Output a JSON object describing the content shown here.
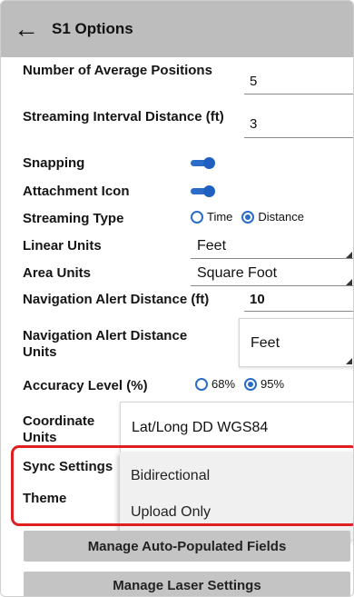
{
  "header": {
    "back_icon": "back-arrow-icon",
    "title": "S1 Options"
  },
  "settings": {
    "avg_positions": {
      "label": "Number of Average Positions",
      "value": "5"
    },
    "streaming_interval": {
      "label": "Streaming Interval Distance (ft)",
      "value": "3"
    },
    "snapping": {
      "label": "Snapping",
      "enabled": true
    },
    "attachment_icon": {
      "label": "Attachment Icon",
      "enabled": true
    },
    "streaming_type": {
      "label": "Streaming Type",
      "options": [
        "Time",
        "Distance"
      ],
      "selected": "Distance"
    },
    "linear_units": {
      "label": "Linear Units",
      "value": "Feet"
    },
    "area_units": {
      "label": "Area Units",
      "value": "Square Foot"
    },
    "nav_alert_distance": {
      "label": "Navigation Alert Distance (ft)",
      "value": "10"
    },
    "nav_alert_units": {
      "label": "Navigation Alert Distance Units",
      "value": "Feet"
    },
    "accuracy_level": {
      "label": "Accuracy Level (%)",
      "options": [
        "68%",
        "95%"
      ],
      "selected": "95%"
    },
    "coordinate_units": {
      "label": "Coordinate Units",
      "value": "Lat/Long DD WGS84"
    },
    "sync_settings": {
      "label": "Sync Settings"
    },
    "theme": {
      "label": "Theme"
    }
  },
  "sync_dropdown": {
    "options": [
      "Bidirectional",
      "Upload Only"
    ]
  },
  "buttons": {
    "manage_auto_populated": "Manage Auto-Populated Fields",
    "manage_laser": "Manage Laser Settings"
  },
  "colors": {
    "accent": "#2a6cc8",
    "highlight": "#e02020",
    "header_bg": "#bdbdbd"
  }
}
